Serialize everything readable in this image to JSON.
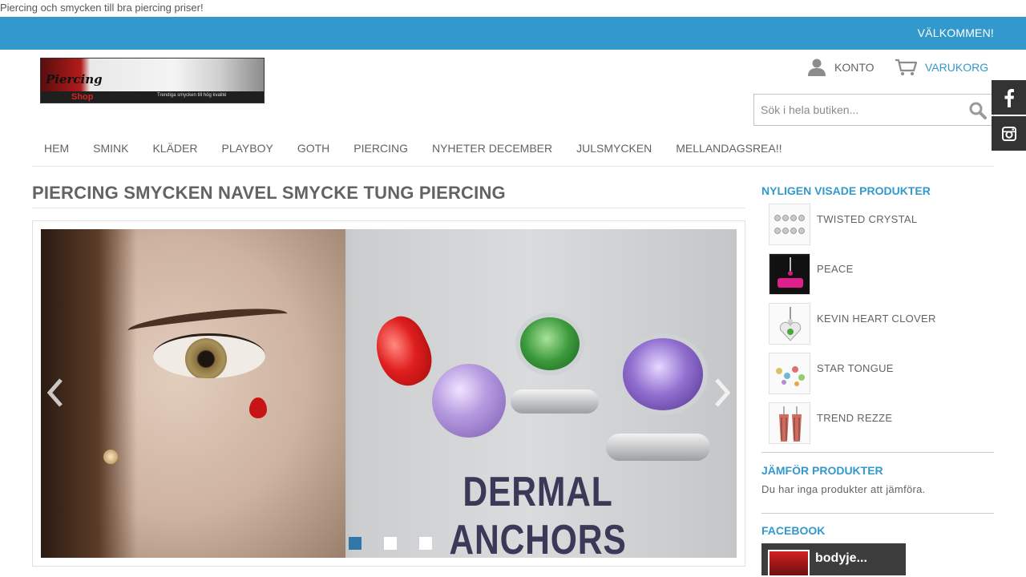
{
  "header": {
    "tagline": "Piercing och smycken till bra piercing priser!",
    "welcome": "VÄLKOMMEN!",
    "logo": {
      "word1": "Piercing",
      "word2": "Shop",
      "sub": "Trendiga smycken till hög kvalité"
    },
    "account_label": "KONTO",
    "cart_label": "VARUKORG",
    "search_placeholder": "Sök i hela butiken..."
  },
  "social": {
    "facebook_icon": "facebook-icon",
    "instagram_icon": "instagram-icon"
  },
  "nav": {
    "items": [
      {
        "label": "HEM"
      },
      {
        "label": "SMINK"
      },
      {
        "label": "KLÄDER"
      },
      {
        "label": "PLAYBOY"
      },
      {
        "label": "GOTH"
      },
      {
        "label": "PIERCING"
      },
      {
        "label": "NYHETER DECEMBER"
      },
      {
        "label": "JULSMYCKEN"
      },
      {
        "label": "MELLANDAGSREA!!"
      }
    ]
  },
  "main": {
    "title": "PIERCING SMYCKEN NAVEL SMYCKE TUNG PIERCING",
    "slider": {
      "caption": "DERMAL ANCHORS",
      "slide_count": 3,
      "active_index": 0
    }
  },
  "sidebar": {
    "recent_title": "NYLIGEN VISADE PRODUKTER",
    "recent": [
      {
        "name": "TWISTED CRYSTAL"
      },
      {
        "name": "PEACE"
      },
      {
        "name": "KEVIN HEART CLOVER"
      },
      {
        "name": "STAR TONGUE"
      },
      {
        "name": "TREND REZZE"
      }
    ],
    "compare_title": "JÄMFÖR PRODUKTER",
    "compare_text": "Du har inga produkter att jämföra.",
    "facebook_title": "FACEBOOK",
    "facebook_page_name": "bodyje..."
  },
  "colors": {
    "accent": "#3399cc",
    "text": "#636363",
    "social_bg": "#333333",
    "active_dot": "#3078a8"
  }
}
